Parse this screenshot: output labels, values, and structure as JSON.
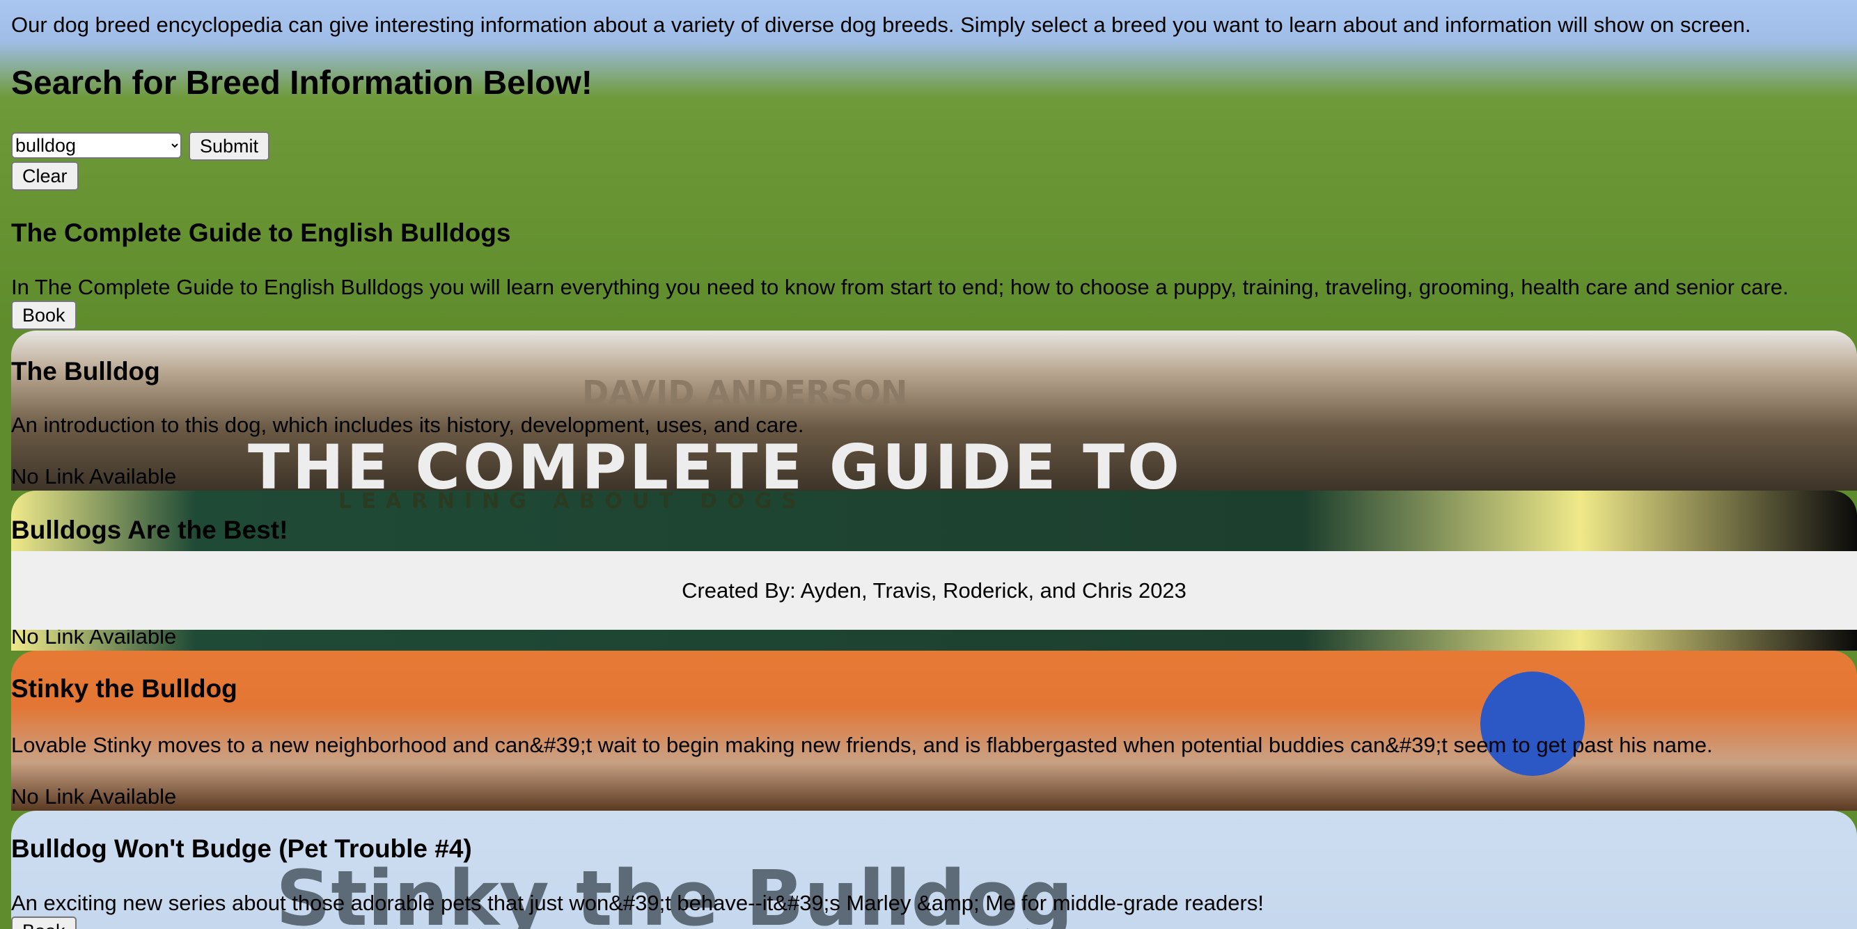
{
  "intro": "Our dog breed encyclopedia can give interesting information about a variety of diverse dog breeds. Simply select a breed you want to learn about and information will show on screen.",
  "search_title": "Search for Breed Information Below!",
  "breed_select": {
    "selected": "bulldog"
  },
  "buttons": {
    "submit": "Submit",
    "clear": "Clear"
  },
  "results": [
    {
      "title": "The Complete Guide to English Bulldogs",
      "description": "In The Complete Guide to English Bulldogs you will learn everything you need to know from start to end; how to choose a puppy, training, traveling, grooming, health care and senior care.",
      "link": "Book"
    },
    {
      "title": "The Bulldog",
      "description": "An introduction to this dog, which includes its history, development, uses, and care.",
      "link": "No Link Available",
      "cover_text": [
        "DAVID ANDERSON",
        "THE COMPLETE GUIDE TO"
      ]
    },
    {
      "title": "Bulldogs Are the Best!",
      "link": "No Link Available",
      "cover_text": [
        "LEARNING ABOUT DOGS"
      ]
    },
    {
      "title": "Stinky the Bulldog",
      "description": "Lovable Stinky moves to a new neighborhood and can&#39;t wait to begin making new friends, and is flabbergasted when potential buddies can&#39;t seem to get past his name.",
      "link": "No Link Available"
    },
    {
      "title": "Bulldog Won't Budge (Pet Trouble #4)",
      "description": "An exciting new series about those adorable pets that just won&#39;t behave--it&#39;s Marley &amp; Me for middle-grade readers!",
      "link": "Book",
      "cover_text": [
        "Stinky the Bulldog"
      ]
    }
  ],
  "footer": "Created By: Ayden, Travis, Roderick, and Chris 2023"
}
